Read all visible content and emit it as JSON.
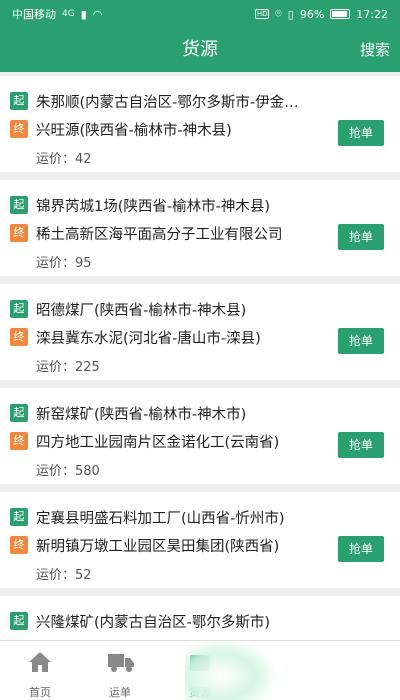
{
  "status_bar": {
    "carrier": "中国移动",
    "network": "4G",
    "battery": "96%",
    "time": "17:22"
  },
  "header": {
    "title": "货源",
    "search_label": "搜索"
  },
  "labels": {
    "start_tag": "起",
    "end_tag": "终",
    "price_prefix": "运价：",
    "grab_button": "抢单"
  },
  "orders": [
    {
      "from": "朱那顺(内蒙古自治区-鄂尔多斯市-伊金霍洛旗)",
      "to": "兴旺源(陕西省-榆林市-神木县)",
      "price": "42"
    },
    {
      "from": "锦界芮城1场(陕西省-榆林市-神木县)",
      "to": "稀土高新区海平面高分子工业有限公司",
      "price": "95"
    },
    {
      "from": "昭德煤厂(陕西省-榆林市-神木县)",
      "to": "滦县冀东水泥(河北省-唐山市-滦县)",
      "price": "225"
    },
    {
      "from": "新窑煤矿(陕西省-榆林市-神木市)",
      "to": "四方地工业园南片区金诺化工(云南省)",
      "price": "580"
    },
    {
      "from": "定襄县明盛石料加工厂(山西省-忻州市)",
      "to": "新明镇万墩工业园区昊田集团(陕西省)",
      "price": "52"
    },
    {
      "from": "兴隆煤矿(内蒙古自治区-鄂尔多斯市)",
      "to": "",
      "price": ""
    }
  ],
  "tabs": [
    {
      "label": "首页",
      "icon": "home-icon"
    },
    {
      "label": "运单",
      "icon": "truck-icon"
    },
    {
      "label": "货源",
      "icon": "cargo-icon"
    }
  ],
  "colors": {
    "primary": "#2aa06f",
    "end_tag": "#f0883c"
  }
}
